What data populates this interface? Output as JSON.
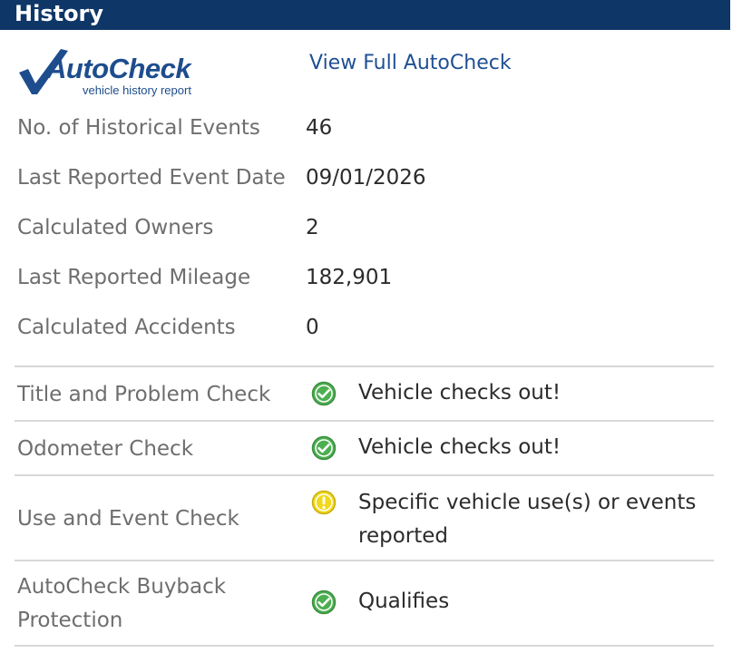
{
  "header": {
    "title": "History"
  },
  "logo": {
    "word": "AutoCheck",
    "tagline": "vehicle history report"
  },
  "link": {
    "view_full": "View Full AutoCheck"
  },
  "summary": [
    {
      "label": "No. of Historical Events",
      "value": "46"
    },
    {
      "label": "Last Reported Event Date",
      "value": "09/01/2026"
    },
    {
      "label": "Calculated Owners",
      "value": "2"
    },
    {
      "label": "Last Reported Mileage",
      "value": "182,901"
    },
    {
      "label": "Calculated Accidents",
      "value": "0"
    }
  ],
  "checks": [
    {
      "label": "Title and Problem Check",
      "status": "pass",
      "icon": "check-circle-icon",
      "text": "Vehicle checks out!"
    },
    {
      "label": "Odometer Check",
      "status": "pass",
      "icon": "check-circle-icon",
      "text": "Vehicle checks out!"
    },
    {
      "label": "Use and Event Check",
      "status": "warning",
      "icon": "warning-circle-icon",
      "text": "Specific vehicle use(s) or events reported"
    },
    {
      "label": "AutoCheck Buyback Protection",
      "status": "pass",
      "icon": "check-circle-icon",
      "text": "Qualifies"
    }
  ],
  "colors": {
    "header_bg": "#0e3768",
    "brand_blue": "#1d4d8d",
    "link": "#1f4f94",
    "pass_green": "#4caf50",
    "warning_yellow": "#f2d81b"
  }
}
